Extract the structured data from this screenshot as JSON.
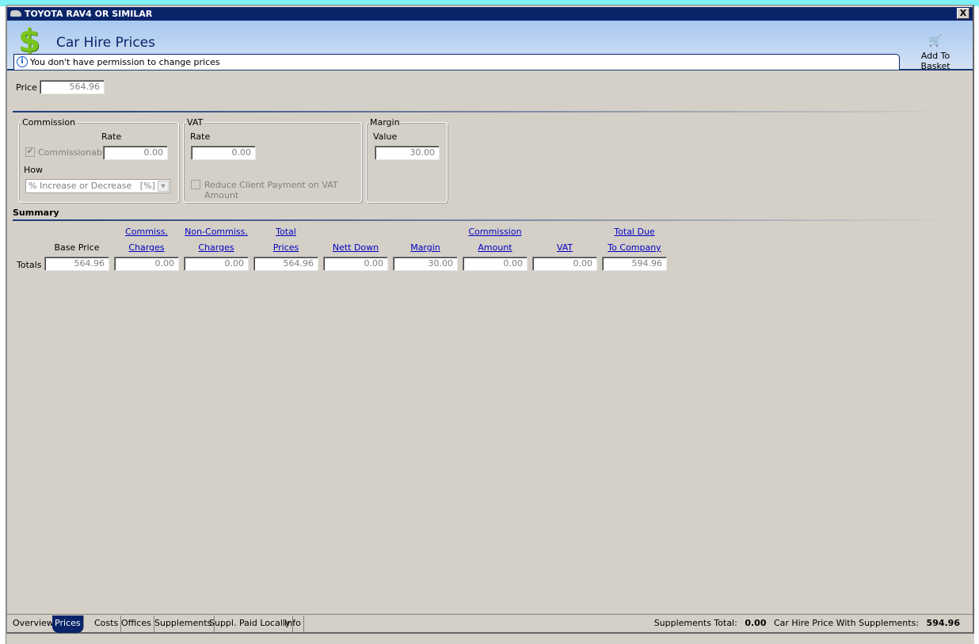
{
  "window": {
    "title": "TOYOTA RAV4 OR SIMILAR",
    "close_label": "X"
  },
  "header": {
    "title": "Car Hire Prices",
    "info_message": "You don't have permission to change prices",
    "add_to_basket": "Add To Basket"
  },
  "price": {
    "label": "Price",
    "value": "564.96"
  },
  "commission": {
    "title": "Commission",
    "rate_label": "Rate",
    "commissionable_label": "Commissionable",
    "commissionable_checked": true,
    "rate_value": "0.00",
    "how_label": "How",
    "how_value": "% Increase or Decrease   [%]"
  },
  "vat": {
    "title": "VAT",
    "rate_label": "Rate",
    "rate_value": "0.00",
    "reduce_label": "Reduce Client Payment on VAT Amount",
    "reduce_checked": false
  },
  "margin": {
    "title": "Margin",
    "value_label": "Value",
    "value": "30.00"
  },
  "summary": {
    "title": "Summary",
    "row_label": "Totals",
    "columns": [
      {
        "line1": "",
        "line2": "Base Price",
        "link": false,
        "value": "564.96"
      },
      {
        "line1": "Commiss.",
        "line2": "Charges",
        "link": true,
        "value": "0.00"
      },
      {
        "line1": "Non-Commiss.",
        "line2": "Charges",
        "link": true,
        "value": "0.00"
      },
      {
        "line1": "Total",
        "line2": "Prices",
        "link": true,
        "value": "564.96"
      },
      {
        "line1": "",
        "line2": "Nett Down",
        "link": true,
        "value": "0.00"
      },
      {
        "line1": "",
        "line2": "Margin",
        "link": true,
        "value": "30.00"
      },
      {
        "line1": "Commission",
        "line2": "Amount",
        "link": true,
        "value": "0.00"
      },
      {
        "line1": "",
        "line2": "VAT",
        "link": true,
        "value": "0.00"
      },
      {
        "line1": "Total Due",
        "line2": "To Company",
        "link": true,
        "value": "594.96"
      }
    ]
  },
  "tabs": [
    {
      "label": "Overview",
      "active": false
    },
    {
      "label": "Prices",
      "active": true
    },
    {
      "label": "Costs",
      "active": false
    },
    {
      "label": "Offices",
      "active": false
    },
    {
      "label": "Supplements",
      "active": false
    },
    {
      "label": "Suppl. Paid Locally",
      "active": false
    },
    {
      "label": "Info",
      "active": false
    }
  ],
  "status": {
    "supplements_total_label": "Supplements Total:",
    "supplements_total": "0.00",
    "with_supplements_label": "Car Hire Price With Supplements:",
    "with_supplements": "594.96"
  },
  "colors": {
    "titlebar": "#0a246a",
    "link": "#0000c0",
    "dollar": "#7ac41e"
  }
}
